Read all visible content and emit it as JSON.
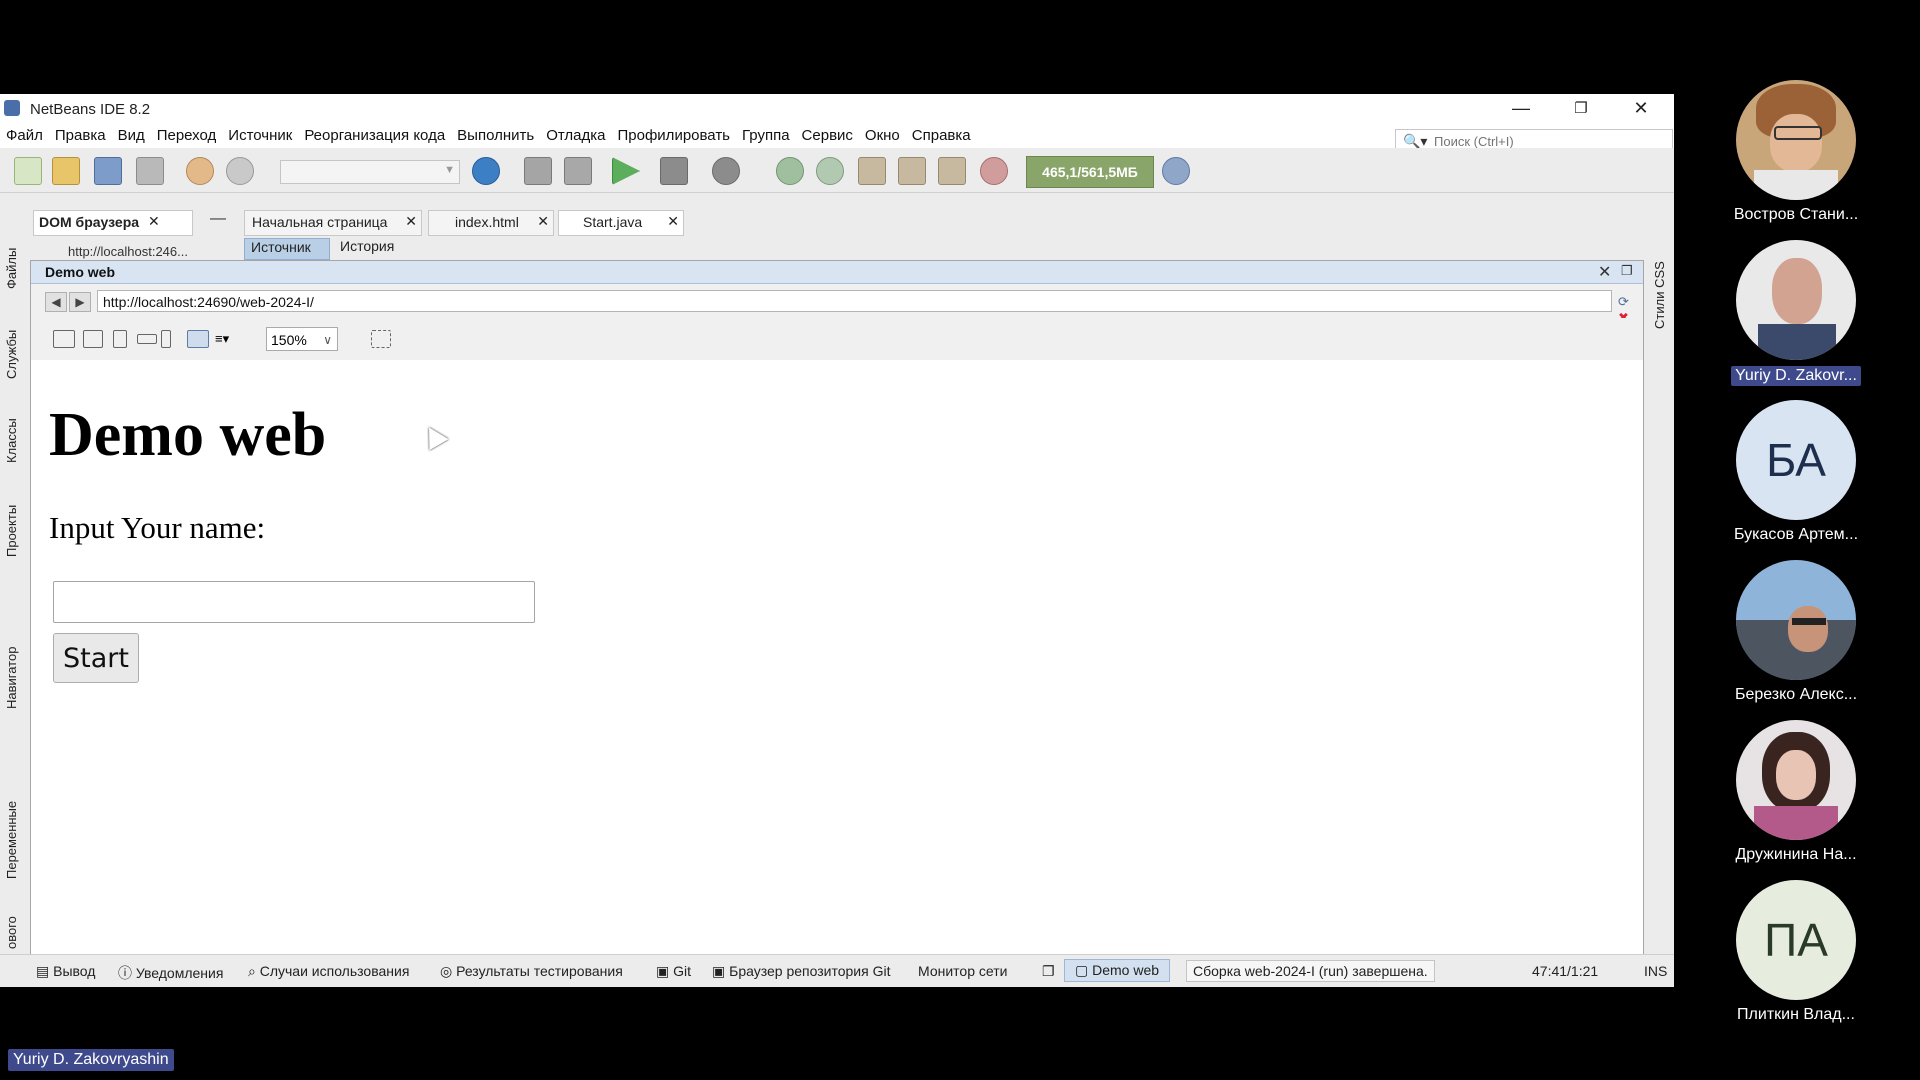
{
  "window": {
    "title": "NetBeans IDE 8.2"
  },
  "menu": [
    "Файл",
    "Правка",
    "Вид",
    "Переход",
    "Источник",
    "Реорганизация кода",
    "Выполнить",
    "Отладка",
    "Профилировать",
    "Группа",
    "Сервис",
    "Окно",
    "Справка"
  ],
  "search": {
    "placeholder": "Поиск (Ctrl+I)"
  },
  "toolbar": {
    "memory": "465,1/561,5МБ"
  },
  "left_panels": [
    "Файлы",
    "Службы",
    "Классы",
    "Проекты",
    "Навигатор",
    "Переменные",
    "ового"
  ],
  "right_panels": [
    "Стили CSS"
  ],
  "dom_panel": {
    "title": "DOM браузера",
    "url": "http://localhost:246..."
  },
  "editor_tabs": [
    "Начальная страница",
    "index.html",
    "Start.java"
  ],
  "sub_tabs": [
    "Источник",
    "История"
  ],
  "web_panel": {
    "title": "Demo web",
    "url": "http://localhost:24690/web-2024-I/",
    "zoom": "150%"
  },
  "page": {
    "heading": "Demo web",
    "prompt": "Input Your name:",
    "input_value": "",
    "button": "Start"
  },
  "statusbar": {
    "items": [
      "Вывод",
      "Уведомления",
      "Случаи использования",
      "Результаты тестирования",
      "Git",
      "Браузер репозитория Git",
      "Монитор сети"
    ],
    "active": "Demo web",
    "build": "Сборка web-2024-I (run) завершена.",
    "position": "47:41/1:21",
    "mode": "INS"
  },
  "participants": [
    {
      "name": "Востров Стани..."
    },
    {
      "name": "Yuriy D. Zakovr..."
    },
    {
      "name": "Букасов Артем...",
      "initials": "БА"
    },
    {
      "name": "Березко Алекс..."
    },
    {
      "name": "Дружинина На..."
    },
    {
      "name": "Плиткин Влад...",
      "initials": "ПА"
    }
  ],
  "speaker": "Yuriy D. Zakovryashin"
}
